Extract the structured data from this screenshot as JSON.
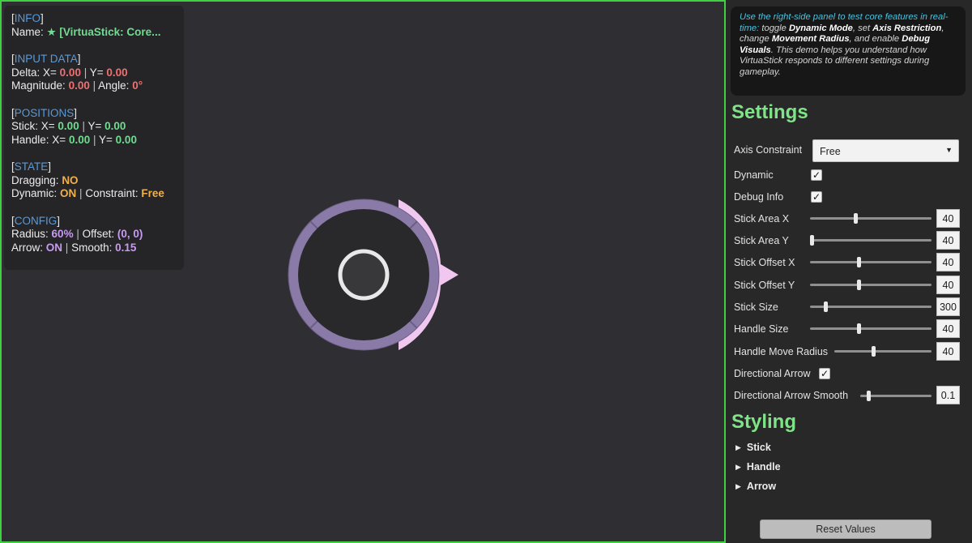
{
  "info": {
    "info_header": "INFO",
    "name_label": "Name:",
    "name_star": "★",
    "name_value": "[VirtuaStick: Core...",
    "input_header": "INPUT DATA",
    "delta_label": "Delta: X=",
    "delta_x": "0.00",
    "delta_y_label": "Y=",
    "delta_y": "0.00",
    "magnitude_label": "Magnitude:",
    "magnitude": "0.00",
    "angle_label": "Angle:",
    "angle": "0°",
    "positions_header": "POSITIONS",
    "stick_label": "Stick: X=",
    "stick_x": "0.00",
    "stick_y_label": "Y=",
    "stick_y": "0.00",
    "handle_label": "Handle: X=",
    "handle_x": "0.00",
    "handle_y_label": "Y=",
    "handle_y": "0.00",
    "state_header": "STATE",
    "dragging_label": "Dragging:",
    "dragging": "NO",
    "dynamic_label": "Dynamic:",
    "dynamic": "ON",
    "constraint_label": "Constraint:",
    "constraint": "Free",
    "config_header": "CONFIG",
    "radius_label": "Radius:",
    "radius": "60%",
    "offset_label": "Offset:",
    "offset": "(0, 0)",
    "arrow_label": "Arrow:",
    "arrow": "ON",
    "smooth_label": "Smooth:",
    "smooth": "0.15"
  },
  "hint": {
    "part1": "Use the right-side panel to test core features in real-time:",
    "part2": " toggle ",
    "dynamic_mode": "Dynamic Mode",
    "part3": ", set ",
    "axis_restriction": "Axis Restriction",
    "part4": ", change ",
    "movement_radius": "Movement Radius",
    "part5": ", and enable ",
    "debug_visuals": "Debug Visuals",
    "part6": ". This demo helps you understand how VirtuaStick responds to different settings during gameplay."
  },
  "settings": {
    "title": "Settings",
    "axis_constraint_label": "Axis Constraint",
    "axis_constraint_value": "Free",
    "dynamic_label": "Dynamic",
    "dynamic_checked": true,
    "debug_info_label": "Debug Info",
    "debug_info_checked": true,
    "sliders": [
      {
        "label": "Stick Area X",
        "value": "40",
        "fraction": 0.37
      },
      {
        "label": "Stick Area Y",
        "value": "40",
        "fraction": 0.0
      },
      {
        "label": "Stick Offset X",
        "value": "40",
        "fraction": 0.4
      },
      {
        "label": "Stick Offset Y",
        "value": "40",
        "fraction": 0.4
      },
      {
        "label": "Stick Size",
        "value": "300",
        "fraction": 0.12
      },
      {
        "label": "Handle Size",
        "value": "40",
        "fraction": 0.4
      },
      {
        "label": "Handle Move Radius",
        "value": "40",
        "fraction": 0.4
      }
    ],
    "directional_arrow_label": "Directional Arrow",
    "directional_arrow_checked": true,
    "arrow_smooth_label": "Directional Arrow Smooth",
    "arrow_smooth_value": "0.1",
    "arrow_smooth_fraction": 0.1
  },
  "styling": {
    "title": "Styling",
    "foldouts": [
      "Stick",
      "Handle",
      "Arrow"
    ]
  },
  "reset_label": "Reset Values",
  "colors": {
    "accent_green": "#7fe487",
    "viewport_border": "#3fd13f",
    "ring": "#8a7aa8",
    "arrow": "#f0c8ef"
  },
  "icons": {
    "check": "✓",
    "foldout_triangle": "▶",
    "dropdown_arrow": "▼"
  }
}
